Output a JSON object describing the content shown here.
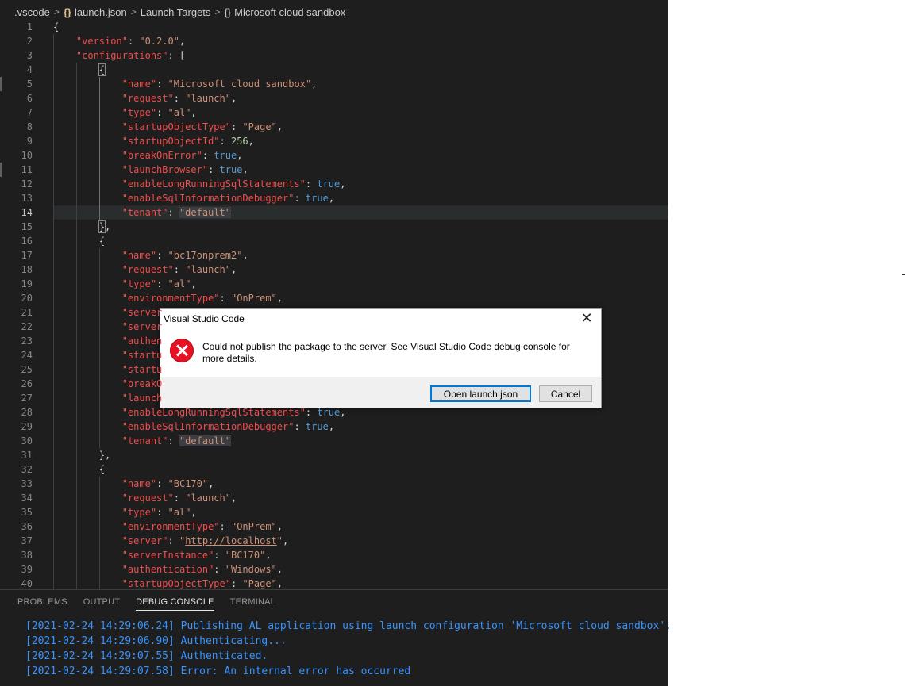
{
  "breadcrumb": {
    "folder": ".vscode",
    "file": "launch.json",
    "section": "Launch Targets",
    "item": "Microsoft cloud sandbox",
    "brace_glyph": "{}",
    "separator": ">"
  },
  "editor": {
    "current_line": 14,
    "lines": [
      {
        "n": "1",
        "indent": 0,
        "t": [
          [
            "p",
            "{"
          ]
        ]
      },
      {
        "n": "2",
        "indent": 1,
        "t": [
          [
            "key",
            "\"version\""
          ],
          [
            "p",
            ": "
          ],
          [
            "s",
            "\"0.2.0\""
          ],
          [
            "p",
            ","
          ]
        ]
      },
      {
        "n": "3",
        "indent": 1,
        "t": [
          [
            "key",
            "\"configurations\""
          ],
          [
            "p",
            ": ["
          ]
        ]
      },
      {
        "n": "4",
        "indent": 2,
        "t": [
          [
            "box",
            "{"
          ]
        ]
      },
      {
        "n": "5",
        "indent": 3,
        "t": [
          [
            "key",
            "\"name\""
          ],
          [
            "p",
            ": "
          ],
          [
            "s",
            "\"Microsoft cloud sandbox\""
          ],
          [
            "p",
            ","
          ]
        ]
      },
      {
        "n": "6",
        "indent": 3,
        "t": [
          [
            "key",
            "\"request\""
          ],
          [
            "p",
            ": "
          ],
          [
            "s",
            "\"launch\""
          ],
          [
            "p",
            ","
          ]
        ]
      },
      {
        "n": "7",
        "indent": 3,
        "t": [
          [
            "key",
            "\"type\""
          ],
          [
            "p",
            ": "
          ],
          [
            "s",
            "\"al\""
          ],
          [
            "p",
            ","
          ]
        ]
      },
      {
        "n": "8",
        "indent": 3,
        "t": [
          [
            "key",
            "\"startupObjectType\""
          ],
          [
            "p",
            ": "
          ],
          [
            "s",
            "\"Page\""
          ],
          [
            "p",
            ","
          ]
        ]
      },
      {
        "n": "9",
        "indent": 3,
        "t": [
          [
            "key",
            "\"startupObjectId\""
          ],
          [
            "p",
            ": "
          ],
          [
            "n",
            "256"
          ],
          [
            "p",
            ","
          ]
        ]
      },
      {
        "n": "10",
        "indent": 3,
        "t": [
          [
            "key",
            "\"breakOnError\""
          ],
          [
            "p",
            ": "
          ],
          [
            "b",
            "true"
          ],
          [
            "p",
            ","
          ]
        ]
      },
      {
        "n": "11",
        "indent": 3,
        "t": [
          [
            "key",
            "\"launchBrowser\""
          ],
          [
            "p",
            ": "
          ],
          [
            "b",
            "true"
          ],
          [
            "p",
            ","
          ]
        ]
      },
      {
        "n": "12",
        "indent": 3,
        "t": [
          [
            "key",
            "\"enableLongRunningSqlStatements\""
          ],
          [
            "p",
            ": "
          ],
          [
            "b",
            "true"
          ],
          [
            "p",
            ","
          ]
        ]
      },
      {
        "n": "13",
        "indent": 3,
        "t": [
          [
            "key",
            "\"enableSqlInformationDebugger\""
          ],
          [
            "p",
            ": "
          ],
          [
            "b",
            "true"
          ],
          [
            "p",
            ","
          ]
        ]
      },
      {
        "n": "14",
        "indent": 3,
        "t": [
          [
            "key",
            "\"tenant\""
          ],
          [
            "p",
            ": "
          ],
          [
            "hl",
            "\"default\""
          ]
        ]
      },
      {
        "n": "15",
        "indent": 2,
        "t": [
          [
            "box",
            "}"
          ],
          [
            "p",
            ","
          ]
        ]
      },
      {
        "n": "16",
        "indent": 2,
        "t": [
          [
            "p",
            "{"
          ]
        ]
      },
      {
        "n": "17",
        "indent": 3,
        "t": [
          [
            "key",
            "\"name\""
          ],
          [
            "p",
            ": "
          ],
          [
            "s",
            "\"bc17onprem2\""
          ],
          [
            "p",
            ","
          ]
        ]
      },
      {
        "n": "18",
        "indent": 3,
        "t": [
          [
            "key",
            "\"request\""
          ],
          [
            "p",
            ": "
          ],
          [
            "s",
            "\"launch\""
          ],
          [
            "p",
            ","
          ]
        ]
      },
      {
        "n": "19",
        "indent": 3,
        "t": [
          [
            "key",
            "\"type\""
          ],
          [
            "p",
            ": "
          ],
          [
            "s",
            "\"al\""
          ],
          [
            "p",
            ","
          ]
        ]
      },
      {
        "n": "20",
        "indent": 3,
        "t": [
          [
            "key",
            "\"environmentType\""
          ],
          [
            "p",
            ": "
          ],
          [
            "s",
            "\"OnPrem\""
          ],
          [
            "p",
            ","
          ]
        ]
      },
      {
        "n": "21",
        "indent": 3,
        "t": [
          [
            "key",
            "\"server"
          ]
        ]
      },
      {
        "n": "22",
        "indent": 3,
        "t": [
          [
            "key",
            "\"server"
          ]
        ]
      },
      {
        "n": "23",
        "indent": 3,
        "t": [
          [
            "key",
            "\"authen"
          ]
        ]
      },
      {
        "n": "24",
        "indent": 3,
        "t": [
          [
            "key",
            "\"startu"
          ]
        ]
      },
      {
        "n": "25",
        "indent": 3,
        "t": [
          [
            "key",
            "\"startu"
          ]
        ]
      },
      {
        "n": "26",
        "indent": 3,
        "t": [
          [
            "key",
            "\"breakO"
          ]
        ]
      },
      {
        "n": "27",
        "indent": 3,
        "t": [
          [
            "key",
            "\"launch"
          ]
        ]
      },
      {
        "n": "28",
        "indent": 3,
        "t": [
          [
            "key",
            "\"enableLongRunningSqlStatements\""
          ],
          [
            "p",
            ": "
          ],
          [
            "b",
            "true"
          ],
          [
            "p",
            ","
          ]
        ]
      },
      {
        "n": "29",
        "indent": 3,
        "t": [
          [
            "key",
            "\"enableSqlInformationDebugger\""
          ],
          [
            "p",
            ": "
          ],
          [
            "b",
            "true"
          ],
          [
            "p",
            ","
          ]
        ]
      },
      {
        "n": "30",
        "indent": 3,
        "t": [
          [
            "key",
            "\"tenant\""
          ],
          [
            "p",
            ": "
          ],
          [
            "hl",
            "\"default\""
          ]
        ]
      },
      {
        "n": "31",
        "indent": 2,
        "t": [
          [
            "p",
            "},"
          ]
        ]
      },
      {
        "n": "32",
        "indent": 2,
        "t": [
          [
            "p",
            "{"
          ]
        ]
      },
      {
        "n": "33",
        "indent": 3,
        "t": [
          [
            "key",
            "\"name\""
          ],
          [
            "p",
            ": "
          ],
          [
            "s",
            "\"BC170\""
          ],
          [
            "p",
            ","
          ]
        ]
      },
      {
        "n": "34",
        "indent": 3,
        "t": [
          [
            "key",
            "\"request\""
          ],
          [
            "p",
            ": "
          ],
          [
            "s",
            "\"launch\""
          ],
          [
            "p",
            ","
          ]
        ]
      },
      {
        "n": "35",
        "indent": 3,
        "t": [
          [
            "key",
            "\"type\""
          ],
          [
            "p",
            ": "
          ],
          [
            "s",
            "\"al\""
          ],
          [
            "p",
            ","
          ]
        ]
      },
      {
        "n": "36",
        "indent": 3,
        "t": [
          [
            "key",
            "\"environmentType\""
          ],
          [
            "p",
            ": "
          ],
          [
            "s",
            "\"OnPrem\""
          ],
          [
            "p",
            ","
          ]
        ]
      },
      {
        "n": "37",
        "indent": 3,
        "t": [
          [
            "key",
            "\"server\""
          ],
          [
            "p",
            ": "
          ],
          [
            "s",
            "\""
          ],
          [
            "url",
            "http://localhost"
          ],
          [
            "s",
            "\""
          ],
          [
            "p",
            ","
          ]
        ]
      },
      {
        "n": "38",
        "indent": 3,
        "t": [
          [
            "key",
            "\"serverInstance\""
          ],
          [
            "p",
            ": "
          ],
          [
            "s",
            "\"BC170\""
          ],
          [
            "p",
            ","
          ]
        ]
      },
      {
        "n": "39",
        "indent": 3,
        "t": [
          [
            "key",
            "\"authentication\""
          ],
          [
            "p",
            ": "
          ],
          [
            "s",
            "\"Windows\""
          ],
          [
            "p",
            ","
          ]
        ]
      },
      {
        "n": "40",
        "indent": 3,
        "t": [
          [
            "key",
            "\"startupObjectType\""
          ],
          [
            "p",
            ": "
          ],
          [
            "s",
            "\"Page\""
          ],
          [
            "p",
            ","
          ]
        ]
      }
    ]
  },
  "panel": {
    "tabs": [
      {
        "label": "PROBLEMS",
        "active": false
      },
      {
        "label": "OUTPUT",
        "active": false
      },
      {
        "label": "DEBUG CONSOLE",
        "active": true
      },
      {
        "label": "TERMINAL",
        "active": false
      }
    ],
    "console_lines": [
      "[2021-02-24 14:29:06.24] Publishing AL application using launch configuration 'Microsoft cloud sandbox'.",
      "[2021-02-24 14:29:06.90] Authenticating...",
      "[2021-02-24 14:29:07.55] Authenticated.",
      "[2021-02-24 14:29:07.58] Error: An internal error has occurred"
    ]
  },
  "dialog": {
    "title": "Visual Studio Code",
    "close_glyph": "✕",
    "message": "Could not publish the package to the server. See Visual Studio Code debug console for more details.",
    "open_button": "Open launch.json",
    "cancel_button": "Cancel"
  },
  "colors": {
    "editor_bg": "#1e1e1e",
    "json_key": "#f14c4c",
    "json_string": "#ce9178",
    "json_number": "#b5cea8",
    "json_bool": "#569cd6",
    "console_text": "#3794ff",
    "error_icon": "#e81123",
    "default_button_border": "#0078d7"
  }
}
